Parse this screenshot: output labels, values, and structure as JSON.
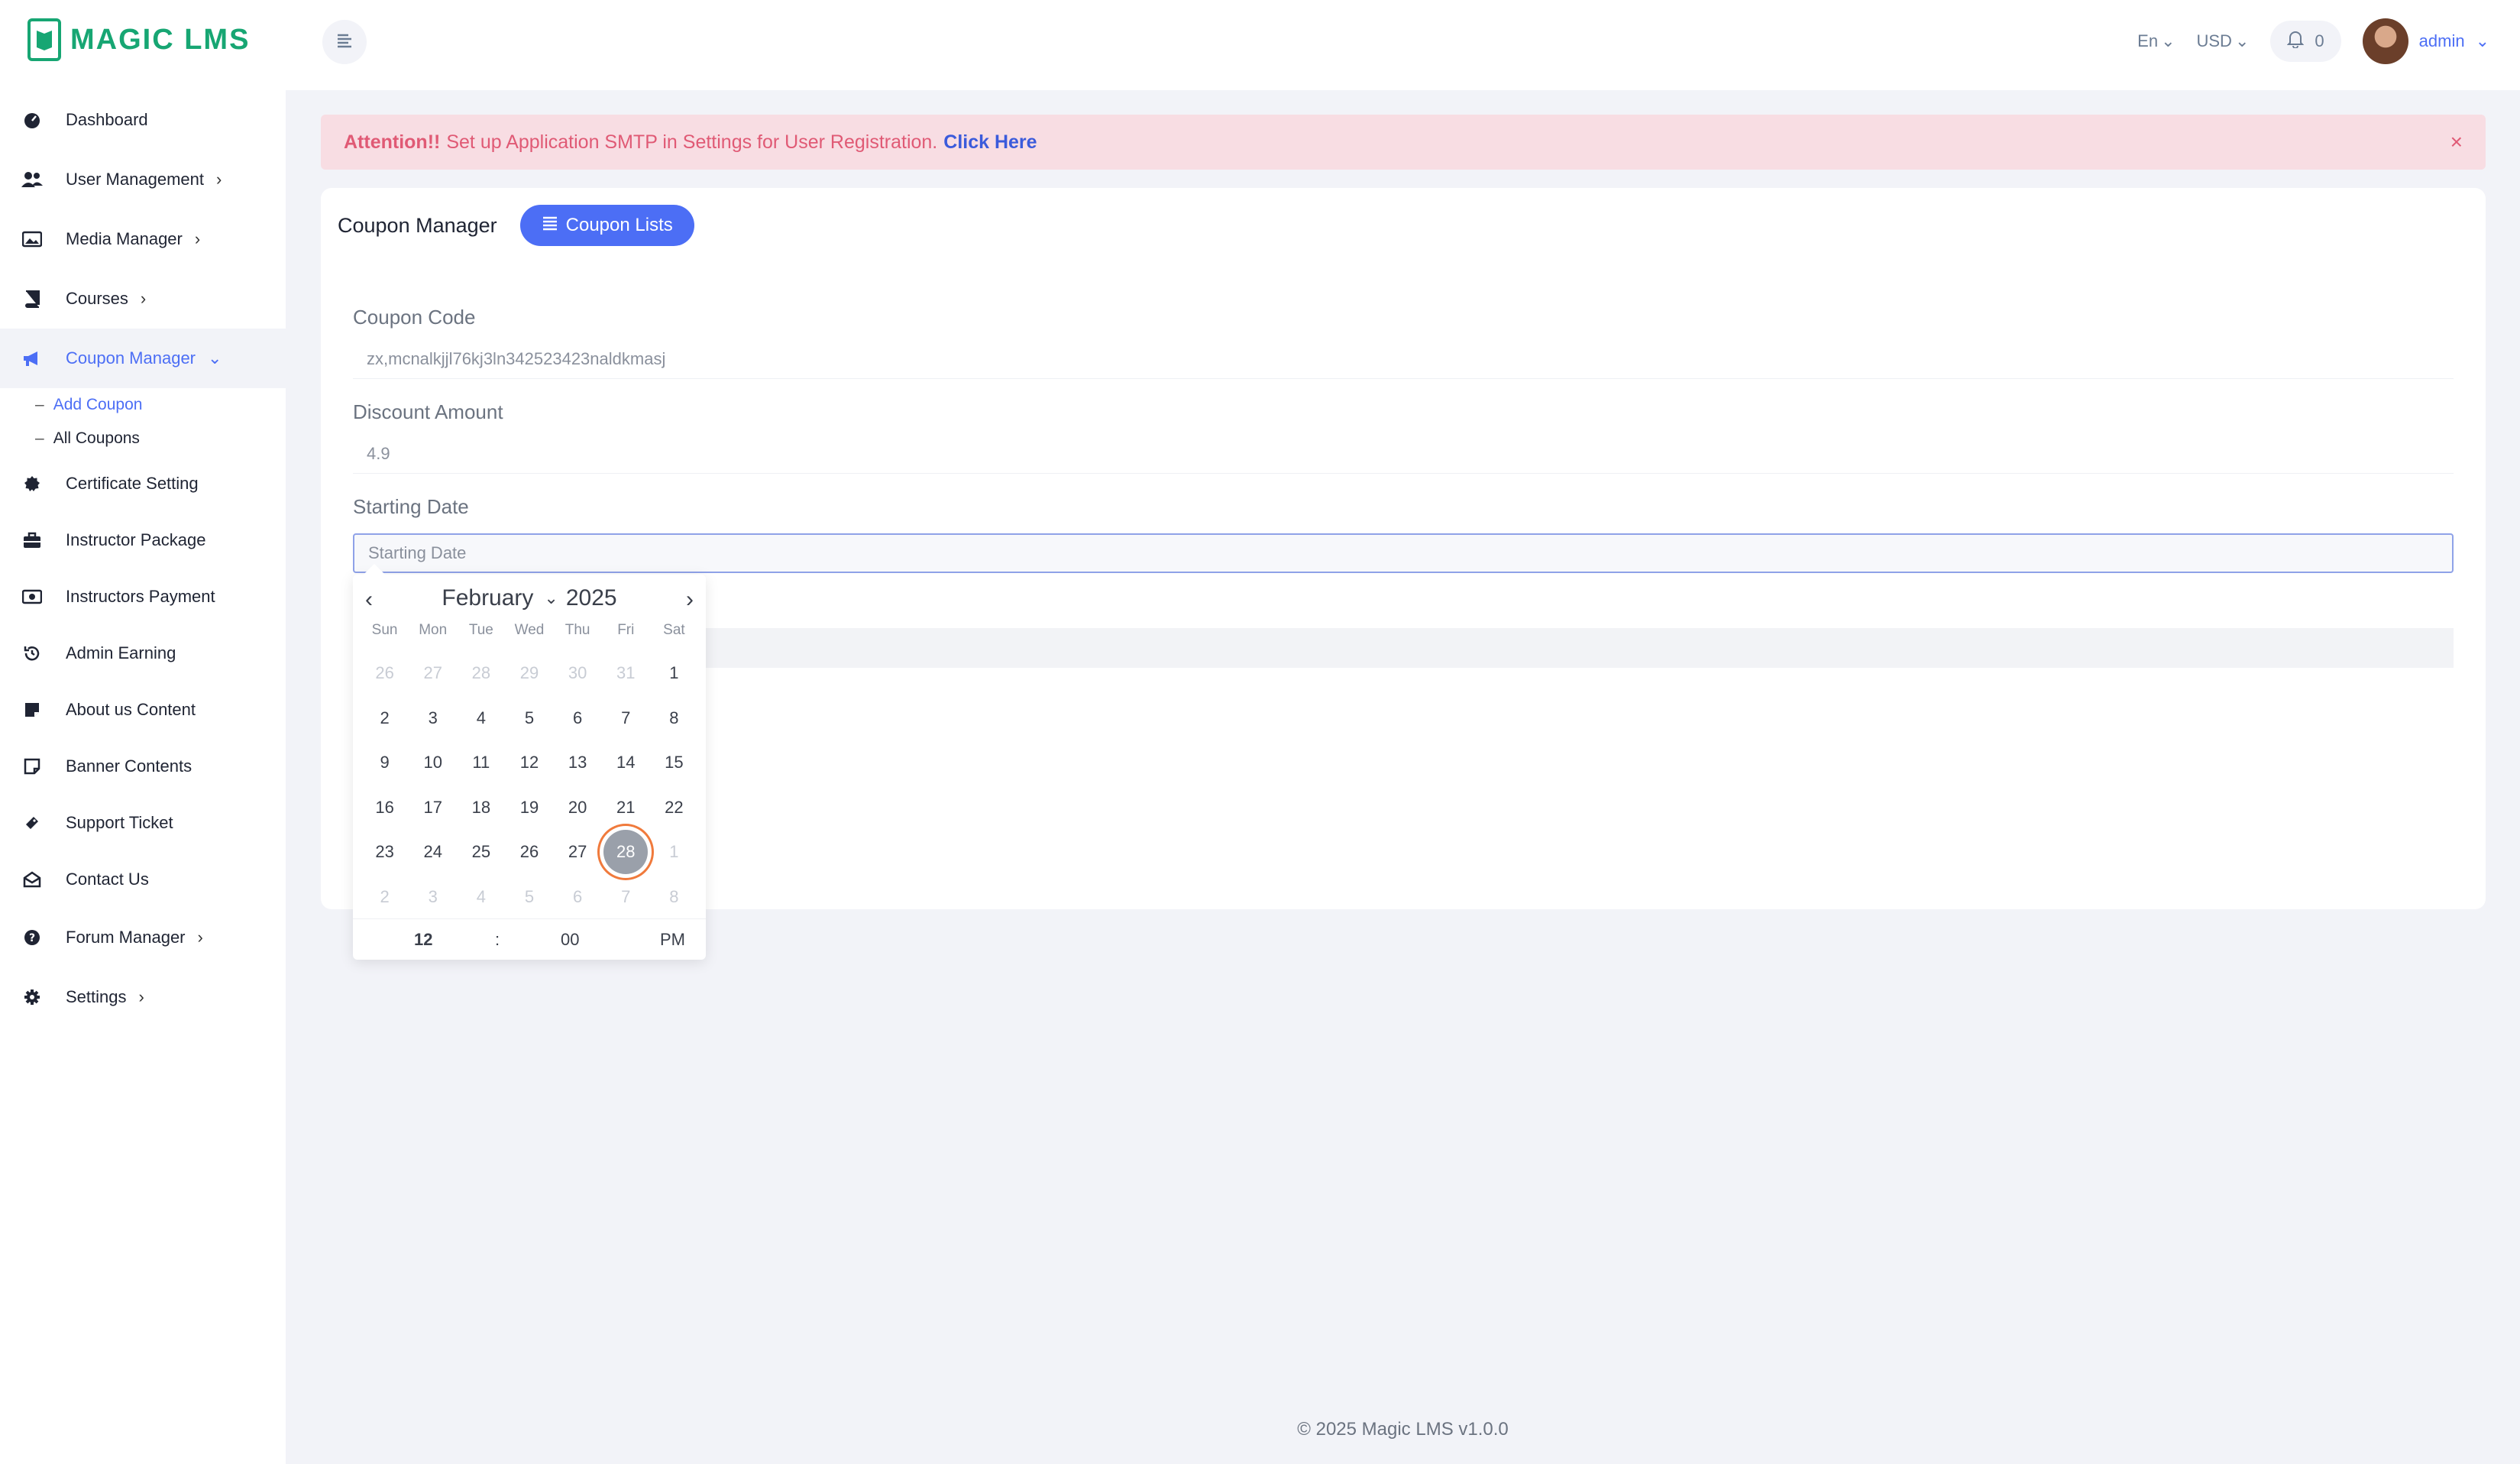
{
  "app": {
    "logo_text": "MAGIC LMS"
  },
  "sidebar": {
    "items": [
      {
        "label": "Dashboard",
        "icon": "dashboard-icon"
      },
      {
        "label": "User Management",
        "icon": "users-icon",
        "has_children": true
      },
      {
        "label": "Media Manager",
        "icon": "image-icon",
        "has_children": true
      },
      {
        "label": "Courses",
        "icon": "book-icon",
        "has_children": true
      },
      {
        "label": "Coupon Manager",
        "icon": "megaphone-icon",
        "has_children": true,
        "expanded": true
      }
    ],
    "coupon_sub": [
      {
        "label": "Add Coupon"
      },
      {
        "label": "All Coupons"
      }
    ],
    "items_after": [
      {
        "label": "Certificate Setting",
        "icon": "badge-icon"
      },
      {
        "label": "Instructor Package",
        "icon": "briefcase-icon"
      },
      {
        "label": "Instructors Payment",
        "icon": "money-icon"
      },
      {
        "label": "Admin Earning",
        "icon": "history-icon"
      },
      {
        "label": "About us Content",
        "icon": "note-icon"
      },
      {
        "label": "Banner Contents",
        "icon": "sticky-icon"
      },
      {
        "label": "Support Ticket",
        "icon": "ticket-icon"
      },
      {
        "label": "Contact Us",
        "icon": "envelope-icon"
      },
      {
        "label": "Forum Manager",
        "icon": "question-icon",
        "has_children": true
      },
      {
        "label": "Settings",
        "icon": "gear-icon",
        "has_children": true
      }
    ]
  },
  "topbar": {
    "language": "En",
    "currency": "USD",
    "notifications": "0",
    "user": "admin"
  },
  "alert": {
    "prefix": "Attention!!",
    "message": "Set up Application SMTP in Settings for User Registration.",
    "link": "Click Here",
    "close": "×"
  },
  "card": {
    "title": "Coupon Manager",
    "button": "Coupon Lists"
  },
  "form": {
    "coupon_code_label": "Coupon Code",
    "coupon_code_value": "zx,mcnalkjjl76kj3ln342523423naldkmasj",
    "discount_label": "Discount Amount",
    "discount_value": "4.9",
    "start_label": "Starting Date",
    "start_placeholder": "Starting Date"
  },
  "datepicker": {
    "month": "February",
    "year": "2025",
    "weekdays": [
      "Sun",
      "Mon",
      "Tue",
      "Wed",
      "Thu",
      "Fri",
      "Sat"
    ],
    "days": [
      {
        "d": "26",
        "m": true
      },
      {
        "d": "27",
        "m": true
      },
      {
        "d": "28",
        "m": true
      },
      {
        "d": "29",
        "m": true
      },
      {
        "d": "30",
        "m": true
      },
      {
        "d": "31",
        "m": true
      },
      {
        "d": "1"
      },
      {
        "d": "2"
      },
      {
        "d": "3"
      },
      {
        "d": "4"
      },
      {
        "d": "5"
      },
      {
        "d": "6"
      },
      {
        "d": "7"
      },
      {
        "d": "8"
      },
      {
        "d": "9"
      },
      {
        "d": "10"
      },
      {
        "d": "11"
      },
      {
        "d": "12"
      },
      {
        "d": "13"
      },
      {
        "d": "14"
      },
      {
        "d": "15"
      },
      {
        "d": "16"
      },
      {
        "d": "17"
      },
      {
        "d": "18"
      },
      {
        "d": "19"
      },
      {
        "d": "20"
      },
      {
        "d": "21"
      },
      {
        "d": "22"
      },
      {
        "d": "23"
      },
      {
        "d": "24"
      },
      {
        "d": "25"
      },
      {
        "d": "26"
      },
      {
        "d": "27"
      },
      {
        "d": "28",
        "sel": true
      },
      {
        "d": "1",
        "m": true
      },
      {
        "d": "2",
        "m": true
      },
      {
        "d": "3",
        "m": true
      },
      {
        "d": "4",
        "m": true
      },
      {
        "d": "5",
        "m": true
      },
      {
        "d": "6",
        "m": true
      },
      {
        "d": "7",
        "m": true
      },
      {
        "d": "8",
        "m": true
      }
    ],
    "hour": "12",
    "separator": ":",
    "minute": "00",
    "ampm": "PM"
  },
  "footer": {
    "text": "© 2025 Magic LMS v1.0.0"
  },
  "colors": {
    "accent": "#4c6ef5",
    "brand": "#17a673",
    "alert_bg": "#f8dde3",
    "alert_text": "#e05a75",
    "selected_ring": "#f07a3c"
  }
}
